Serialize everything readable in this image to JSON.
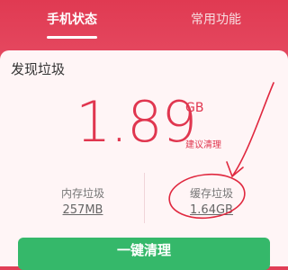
{
  "tabs": [
    {
      "label": "手机状态",
      "active": true
    },
    {
      "label": "常用功能",
      "active": false
    }
  ],
  "card": {
    "title": "发现垃圾",
    "total_value": "1.89",
    "total_unit": "GB",
    "advice": "建议清理",
    "stats": [
      {
        "label": "内存垃圾",
        "value": "257MB"
      },
      {
        "label": "缓存垃圾",
        "value": "1.64GB"
      }
    ]
  },
  "action_button": {
    "label": "一键清理"
  },
  "colors": {
    "accent": "#e0364f",
    "button": "#35b86a",
    "background": "#e8536a"
  }
}
